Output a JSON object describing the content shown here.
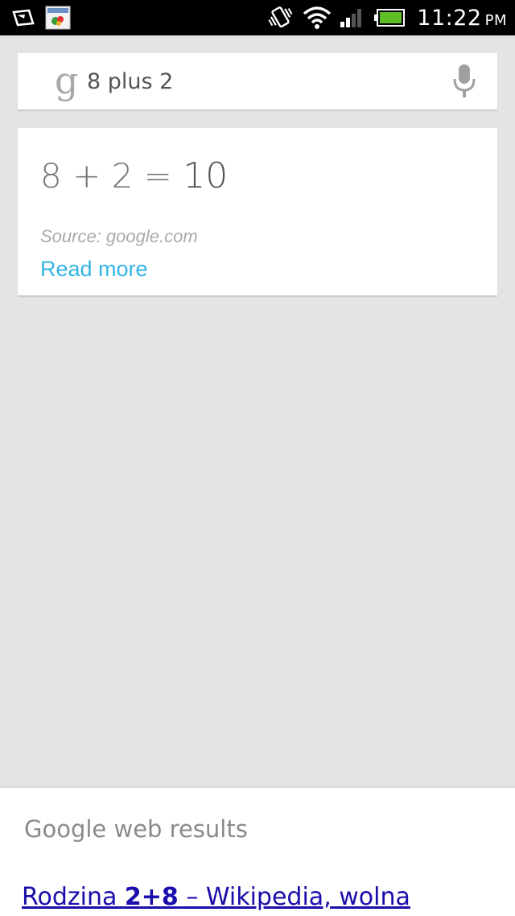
{
  "status_bar": {
    "icons_left": [
      "message-icon",
      "app-notification-icon"
    ],
    "icons_right": [
      "vibrate-icon",
      "wifi-icon",
      "signal-icon",
      "battery-icon"
    ],
    "time": "11:22",
    "ampm": "PM"
  },
  "search": {
    "logo": "g",
    "query": "8 plus 2",
    "mic_icon": "microphone-icon"
  },
  "answer": {
    "expression": "8 + 2 = ",
    "result": "10",
    "source": "Source: google.com",
    "read_more": "Read more"
  },
  "web_results": {
    "title": "Google web results",
    "link_prefix": "Rodzina ",
    "link_bold": "2+8",
    "link_suffix": " – Wikipedia, wolna"
  },
  "colors": {
    "accent": "#33b5e5",
    "link": "#1a0dab",
    "background": "#e4e4e4",
    "battery": "#5fbe24"
  }
}
